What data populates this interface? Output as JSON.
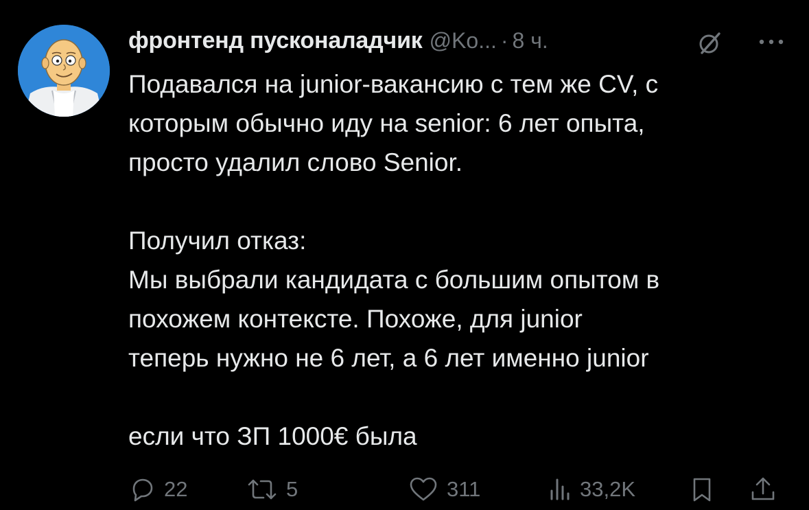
{
  "post": {
    "display_name": "фронтенд пусконаладчик",
    "handle": "@Ko...",
    "separator": "·",
    "time": "8 ч.",
    "text_lines": {
      "l1": "Подавался на junior-вакансию с тем же CV, с",
      "l2": "которым обычно иду на senior: 6 лет опыта,",
      "l3": "просто удалил слово Senior.",
      "l4": "Получил отказ:",
      "l5": "Мы выбрали кандидата с большим опытом в",
      "l6": "похожем контексте. Похоже, для junior",
      "l7": "теперь нужно не 6 лет, а 6 лет именно junior",
      "l8": "если что ЗП 1000€ была"
    },
    "icons": {
      "avatar": "cartoon-avatar",
      "grok": "grok-icon",
      "more": "more-icon",
      "reply": "reply-icon",
      "retweet": "retweet-icon",
      "like": "heart-icon",
      "views": "views-icon",
      "bookmark": "bookmark-icon",
      "share": "share-icon"
    }
  },
  "actions": {
    "replies": "22",
    "reposts": "5",
    "likes": "311",
    "views": "33,2K"
  },
  "colors": {
    "background": "#000000",
    "text": "#e7e9ea",
    "muted": "#71767b"
  }
}
